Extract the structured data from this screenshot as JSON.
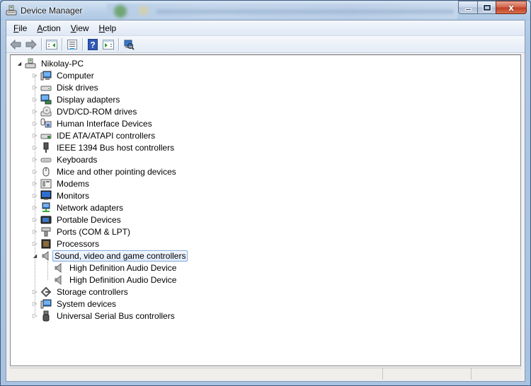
{
  "window": {
    "title": "Device Manager",
    "app_icon": "device-manager-icon",
    "caption_buttons": {
      "minimize": "minimize-icon",
      "maximize": "maximize-icon",
      "close": "close-icon",
      "close_glyph": "x"
    }
  },
  "menu": {
    "items": [
      {
        "label": "File",
        "accel": "F",
        "rest": "ile"
      },
      {
        "label": "Action",
        "accel": "A",
        "rest": "ction"
      },
      {
        "label": "View",
        "accel": "V",
        "rest": "iew"
      },
      {
        "label": "Help",
        "accel": "H",
        "rest": "elp"
      }
    ]
  },
  "toolbar": {
    "buttons": [
      {
        "name": "back",
        "icon": "back-arrow-icon"
      },
      {
        "name": "forward",
        "icon": "forward-arrow-icon"
      },
      {
        "name": "show-hide-console-tree",
        "icon": "console-tree-icon"
      },
      {
        "name": "properties",
        "icon": "properties-icon"
      },
      {
        "name": "help",
        "icon": "help-icon",
        "glyph": "?"
      },
      {
        "name": "show-hide-action-pane",
        "icon": "action-pane-icon"
      },
      {
        "name": "scan-hardware-changes",
        "icon": "scan-hardware-icon"
      }
    ]
  },
  "tree": {
    "root": {
      "label": "Nikolay-PC",
      "icon": "computer-root-icon",
      "expanded": true
    },
    "categories": [
      {
        "label": "Computer",
        "icon": "computer-icon",
        "expanded": false
      },
      {
        "label": "Disk drives",
        "icon": "disk-drive-icon",
        "expanded": false
      },
      {
        "label": "Display adapters",
        "icon": "display-adapter-icon",
        "expanded": false
      },
      {
        "label": "DVD/CD-ROM drives",
        "icon": "dvd-drive-icon",
        "expanded": false
      },
      {
        "label": "Human Interface Devices",
        "icon": "hid-icon",
        "expanded": false
      },
      {
        "label": "IDE ATA/ATAPI controllers",
        "icon": "ide-controller-icon",
        "expanded": false
      },
      {
        "label": "IEEE 1394 Bus host controllers",
        "icon": "firewire-icon",
        "expanded": false
      },
      {
        "label": "Keyboards",
        "icon": "keyboard-icon",
        "expanded": false
      },
      {
        "label": "Mice and other pointing devices",
        "icon": "mouse-icon",
        "expanded": false
      },
      {
        "label": "Modems",
        "icon": "modem-icon",
        "expanded": false
      },
      {
        "label": "Monitors",
        "icon": "monitor-icon",
        "expanded": false
      },
      {
        "label": "Network adapters",
        "icon": "network-adapter-icon",
        "expanded": false
      },
      {
        "label": "Portable Devices",
        "icon": "portable-device-icon",
        "expanded": false
      },
      {
        "label": "Ports (COM & LPT)",
        "icon": "port-icon",
        "expanded": false
      },
      {
        "label": "Processors",
        "icon": "processor-icon",
        "expanded": false
      },
      {
        "label": "Sound, video and game controllers",
        "icon": "speaker-icon",
        "expanded": true,
        "selected": true,
        "children": [
          {
            "label": "High Definition Audio Device",
            "icon": "speaker-icon"
          },
          {
            "label": "High Definition Audio Device",
            "icon": "speaker-icon"
          }
        ]
      },
      {
        "label": "Storage controllers",
        "icon": "storage-controller-icon",
        "expanded": false
      },
      {
        "label": "System devices",
        "icon": "system-device-icon",
        "expanded": false
      },
      {
        "label": "Universal Serial Bus controllers",
        "icon": "usb-icon",
        "expanded": false
      }
    ]
  },
  "expander_glyphs": {
    "collapsed": "▷",
    "expanded": "◢"
  },
  "colors": {
    "selection_border": "#84acdd",
    "selection_fill": "#dfeafb",
    "close_button": "#c7462b"
  }
}
